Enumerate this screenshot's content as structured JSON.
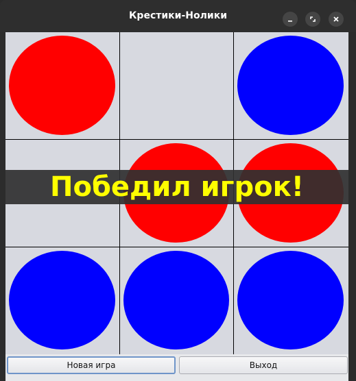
{
  "window": {
    "title": "Крестики-Нолики"
  },
  "board": {
    "cells": [
      {
        "piece": "red"
      },
      {
        "piece": "none"
      },
      {
        "piece": "blue"
      },
      {
        "piece": "none"
      },
      {
        "piece": "red"
      },
      {
        "piece": "red"
      },
      {
        "piece": "blue"
      },
      {
        "piece": "blue"
      },
      {
        "piece": "blue"
      }
    ]
  },
  "colors": {
    "red": "#ff0000",
    "blue": "#0000ff",
    "banner_text": "#ffff00"
  },
  "banner": {
    "message": "Победил игрок!"
  },
  "buttons": {
    "new_game": "Новая игра",
    "exit": "Выход"
  }
}
